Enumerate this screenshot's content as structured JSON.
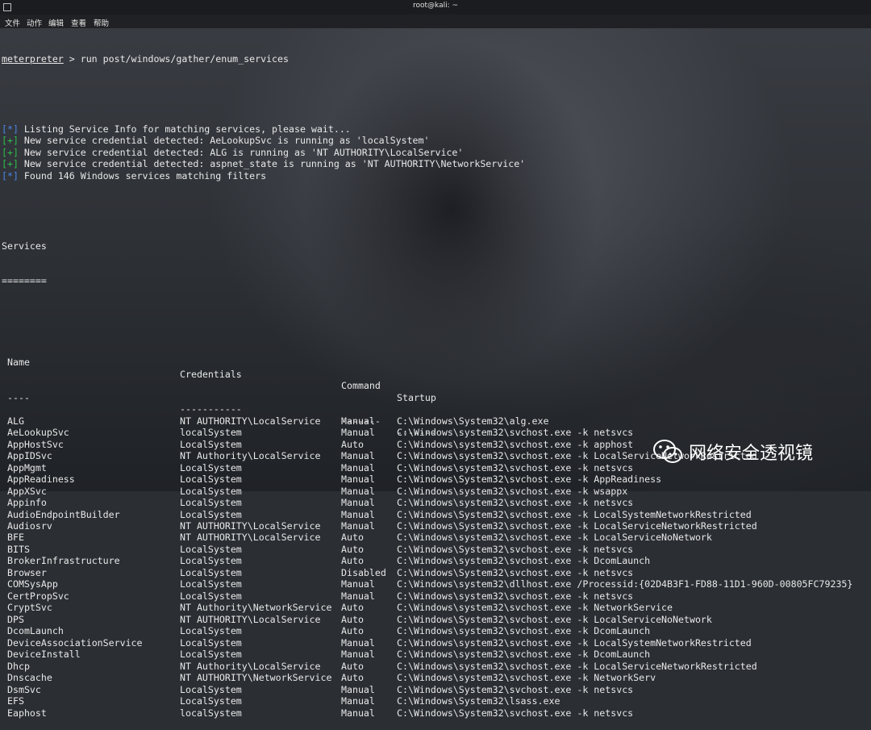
{
  "window": {
    "title": "root@kali: ~",
    "menu": [
      "文件",
      "动作",
      "编辑",
      "查看",
      "帮助"
    ]
  },
  "terminal": {
    "prompt_name": "meterpreter",
    "prompt_rest": " > run post/windows/gather/enum_services",
    "messages": [
      {
        "tag": "[*]",
        "type": "info",
        "text": " Listing Service Info for matching services, please wait..."
      },
      {
        "tag": "[+]",
        "type": "good",
        "text": " New service credential detected: AeLookupSvc is running as 'localSystem'"
      },
      {
        "tag": "[+]",
        "type": "good",
        "text": " New service credential detected: ALG is running as 'NT AUTHORITY\\LocalService'"
      },
      {
        "tag": "[+]",
        "type": "good",
        "text": " New service credential detected: aspnet_state is running as 'NT AUTHORITY\\NetworkService'"
      },
      {
        "tag": "[*]",
        "type": "info",
        "text": " Found 146 Windows services matching filters"
      }
    ],
    "section_title": "Services",
    "section_underline": "========",
    "table": {
      "headers": [
        "Name",
        "Credentials",
        "Command",
        "Startup"
      ],
      "underlines": [
        "----",
        "-----------",
        "-------",
        "-------"
      ],
      "rows": [
        [
          "ALG",
          "NT AUTHORITY\\LocalService",
          "Manual",
          "C:\\Windows\\System32\\alg.exe"
        ],
        [
          "AeLookupSvc",
          "localSystem",
          "Manual",
          "C:\\Windows\\system32\\svchost.exe -k netsvcs"
        ],
        [
          "AppHostSvc",
          "LocalSystem",
          "Auto",
          "C:\\Windows\\system32\\svchost.exe -k apphost"
        ],
        [
          "AppIDSvc",
          "NT Authority\\LocalService",
          "Manual",
          "C:\\Windows\\system32\\svchost.exe -k LocalServiceNetworkRestricted"
        ],
        [
          "AppMgmt",
          "LocalSystem",
          "Manual",
          "C:\\Windows\\system32\\svchost.exe -k netsvcs"
        ],
        [
          "AppReadiness",
          "LocalSystem",
          "Manual",
          "C:\\Windows\\System32\\svchost.exe -k AppReadiness"
        ],
        [
          "AppXSvc",
          "LocalSystem",
          "Manual",
          "C:\\Windows\\system32\\svchost.exe -k wsappx"
        ],
        [
          "Appinfo",
          "LocalSystem",
          "Manual",
          "C:\\Windows\\system32\\svchost.exe -k netsvcs"
        ],
        [
          "AudioEndpointBuilder",
          "LocalSystem",
          "Manual",
          "C:\\Windows\\System32\\svchost.exe -k LocalSystemNetworkRestricted"
        ],
        [
          "Audiosrv",
          "NT AUTHORITY\\LocalService",
          "Manual",
          "C:\\Windows\\System32\\svchost.exe -k LocalServiceNetworkRestricted"
        ],
        [
          "BFE",
          "NT AUTHORITY\\LocalService",
          "Auto",
          "C:\\Windows\\system32\\svchost.exe -k LocalServiceNoNetwork"
        ],
        [
          "BITS",
          "LocalSystem",
          "Auto",
          "C:\\Windows\\System32\\svchost.exe -k netsvcs"
        ],
        [
          "BrokerInfrastructure",
          "LocalSystem",
          "Auto",
          "C:\\Windows\\system32\\svchost.exe -k DcomLaunch"
        ],
        [
          "Browser",
          "LocalSystem",
          "Disabled",
          "C:\\Windows\\System32\\svchost.exe -k netsvcs"
        ],
        [
          "COMSysApp",
          "LocalSystem",
          "Manual",
          "C:\\Windows\\system32\\dllhost.exe /Processid:{02D4B3F1-FD88-11D1-960D-00805FC79235}"
        ],
        [
          "CertPropSvc",
          "LocalSystem",
          "Manual",
          "C:\\Windows\\system32\\svchost.exe -k netsvcs"
        ],
        [
          "CryptSvc",
          "NT Authority\\NetworkService",
          "Auto",
          "C:\\Windows\\system32\\svchost.exe -k NetworkService"
        ],
        [
          "DPS",
          "NT AUTHORITY\\LocalService",
          "Auto",
          "C:\\Windows\\System32\\svchost.exe -k LocalServiceNoNetwork"
        ],
        [
          "DcomLaunch",
          "LocalSystem",
          "Auto",
          "C:\\Windows\\system32\\svchost.exe -k DcomLaunch"
        ],
        [
          "DeviceAssociationService",
          "LocalSystem",
          "Manual",
          "C:\\Windows\\system32\\svchost.exe -k LocalSystemNetworkRestricted"
        ],
        [
          "DeviceInstall",
          "LocalSystem",
          "Manual",
          "C:\\Windows\\system32\\svchost.exe -k DcomLaunch"
        ],
        [
          "Dhcp",
          "NT Authority\\LocalService",
          "Auto",
          "C:\\Windows\\system32\\svchost.exe -k LocalServiceNetworkRestricted"
        ],
        [
          "Dnscache",
          "NT AUTHORITY\\NetworkService",
          "Auto",
          "C:\\Windows\\system32\\svchost.exe -k NetworkServ"
        ],
        [
          "DsmSvc",
          "LocalSystem",
          "Manual",
          "C:\\Windows\\System32\\svchost.exe -k netsvcs"
        ],
        [
          "EFS",
          "LocalSystem",
          "Manual",
          "C:\\Windows\\System32\\lsass.exe"
        ],
        [
          "Eaphost",
          "localSystem",
          "Manual",
          "C:\\Windows\\System32\\svchost.exe -k netsvcs"
        ]
      ]
    }
  },
  "watermark": {
    "text": "网络安全透视镜",
    "icon": "wechat-icon"
  },
  "colors": {
    "info_tag": "#4c86e6",
    "good_tag": "#2fbf4a",
    "text": "#e8e8e8"
  }
}
